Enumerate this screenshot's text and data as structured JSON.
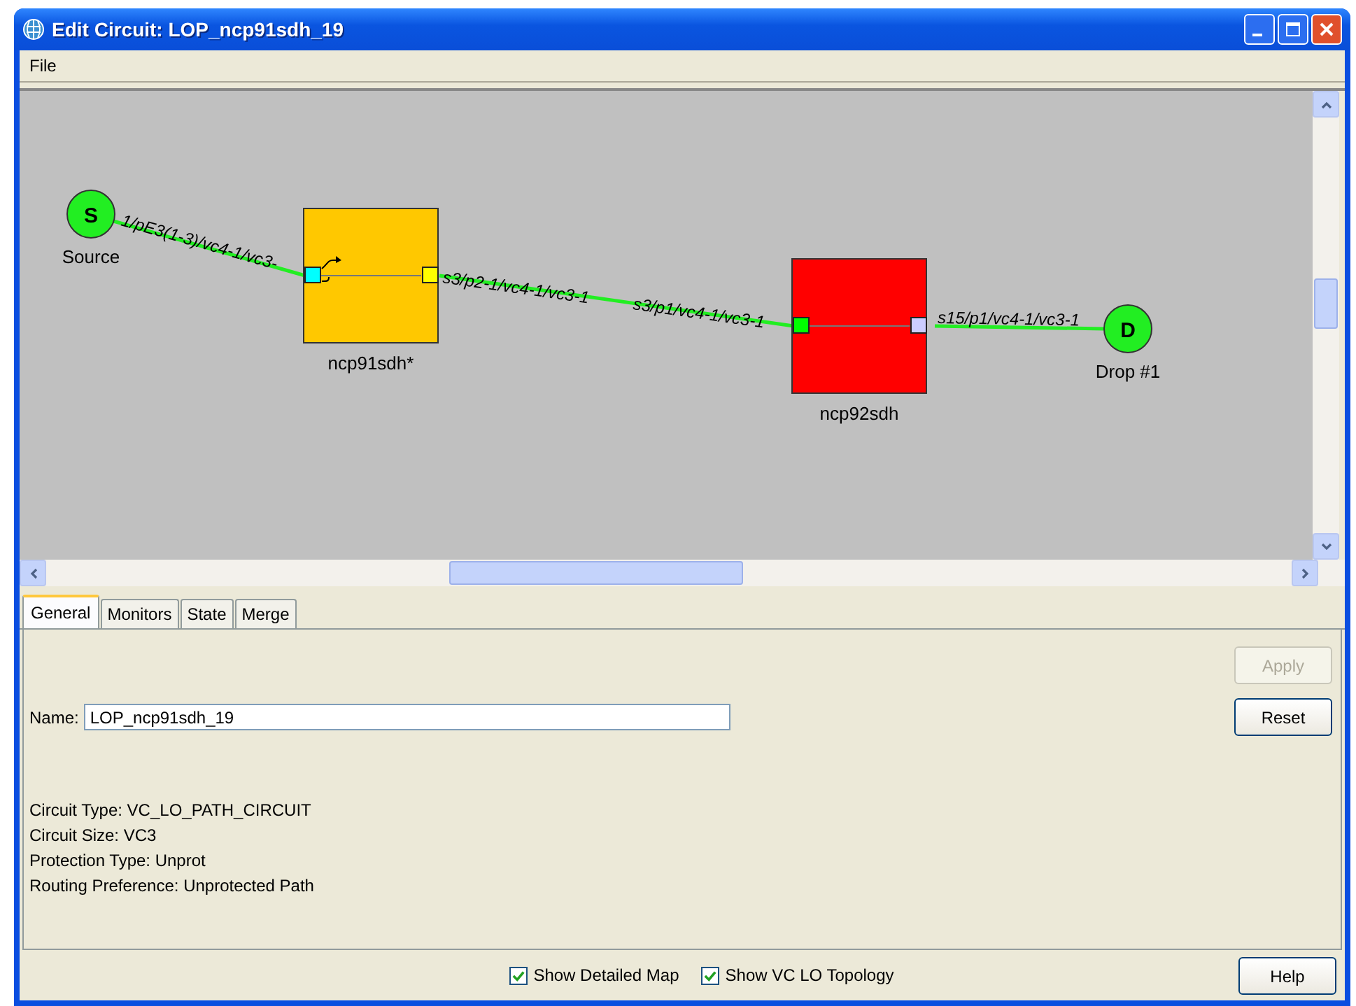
{
  "window": {
    "title": "Edit Circuit: LOP_ncp91sdh_19"
  },
  "menu": [
    {
      "label": "File"
    }
  ],
  "diagram": {
    "endpoints": [
      {
        "letter": "S",
        "label": "Source"
      },
      {
        "letter": "D",
        "label": "Drop #1"
      }
    ],
    "devices": [
      {
        "label": "ncp91sdh*",
        "color": "#ffc800",
        "ports": [
          {
            "color": "#00ffff"
          },
          {
            "color": "#ffff00"
          }
        ]
      },
      {
        "label": "ncp92sdh",
        "color": "#ff0000",
        "ports": [
          {
            "color": "#00ff00"
          },
          {
            "color": "#ccccff"
          }
        ]
      }
    ],
    "links": [
      {
        "labels": [
          "1/pE3(1-3)/vc4-1/vc3-"
        ]
      },
      {
        "labels": [
          "s3/p2-1/vc4-1/vc3-1",
          "s3/p1/vc4-1/vc3-1"
        ]
      },
      {
        "labels": [
          "s15/p1/vc4-1/vc3-1"
        ]
      }
    ]
  },
  "tabs": [
    {
      "label": "General",
      "selected": true
    },
    {
      "label": "Monitors",
      "selected": false
    },
    {
      "label": "State",
      "selected": false
    },
    {
      "label": "Merge",
      "selected": false
    }
  ],
  "general": {
    "name_label": "Name:",
    "name_value": "LOP_ncp91sdh_19",
    "buttons": [
      {
        "label": "Apply",
        "disabled": true
      },
      {
        "label": "Reset",
        "disabled": false
      }
    ],
    "info": [
      "Circuit Type:  VC_LO_PATH_CIRCUIT",
      "Circuit Size: VC3",
      "Protection Type:  Unprot",
      "Routing Preference: Unprotected Path"
    ]
  },
  "options": [
    {
      "label": "Show Detailed Map",
      "checked": true
    },
    {
      "label": "Show VC LO Topology",
      "checked": true
    }
  ],
  "help_button": "Help"
}
